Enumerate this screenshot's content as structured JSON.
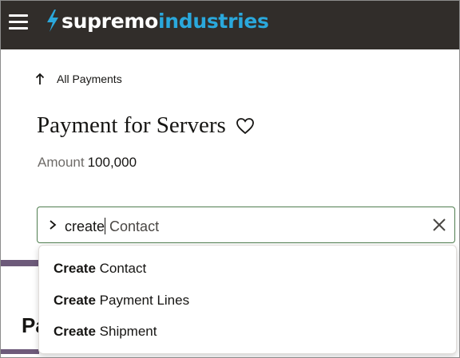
{
  "header": {
    "brand_primary": "supremo",
    "brand_secondary": "industries",
    "menu_icon": "hamburger-menu-icon",
    "logo_icon": "lightning-bolt-icon",
    "colors": {
      "bar": "#312d2a",
      "brand_accent": "#2aa8dc",
      "bolt": "#2aa8dc"
    }
  },
  "back_link": {
    "label": "All Payments",
    "icon": "arrow-up-icon"
  },
  "page": {
    "title": "Payment for Servers",
    "favorite_icon": "heart-outline-icon",
    "amount_label": "Amount",
    "amount_value": "100,000"
  },
  "partial_heading": "Pa",
  "search": {
    "prompt_icon": "chevron-right-icon",
    "typed": "create",
    "completion": " Contact",
    "clear_icon": "close-icon",
    "border_color": "#4f7d4f"
  },
  "suggestions": [
    {
      "bold": "Create",
      "rest": " Contact"
    },
    {
      "bold": "Create",
      "rest": " Payment Lines"
    },
    {
      "bold": "Create",
      "rest": " Shipment"
    }
  ]
}
